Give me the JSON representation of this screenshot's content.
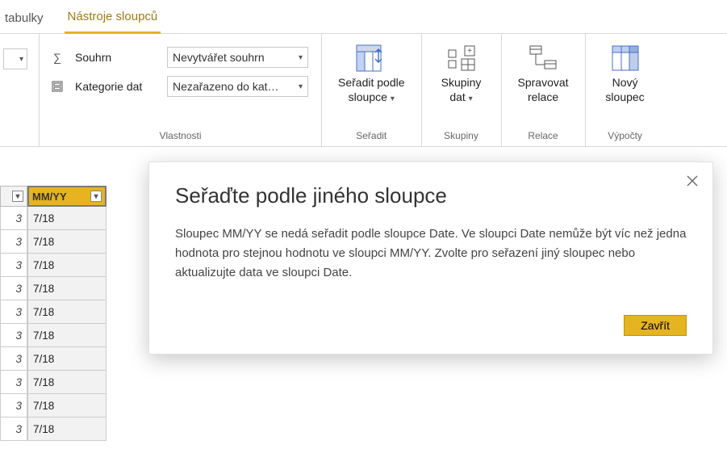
{
  "tabs": {
    "tabulky": "tabulky",
    "nastroje": "Nástroje sloupců"
  },
  "ribbon": {
    "vlastnosti": {
      "souhrn_label": "Souhrn",
      "souhrn_value": "Nevytvářet souhrn",
      "kategorie_label": "Kategorie dat",
      "kategorie_value": "Nezařazeno do kat…",
      "group_label": "Vlastnosti"
    },
    "seradit": {
      "label_line1": "Seřadit podle",
      "label_line2": "sloupce",
      "group_label": "Seřadit"
    },
    "skupiny": {
      "label_line1": "Skupiny",
      "label_line2": "dat",
      "group_label": "Skupiny"
    },
    "relace": {
      "label_line1": "Spravovat",
      "label_line2": "relace",
      "group_label": "Relace"
    },
    "vypocty": {
      "label_line1": "Nový",
      "label_line2": "sloupec",
      "group_label": "Výpočty"
    }
  },
  "grid": {
    "col_b_header": "MM/YY",
    "rows": [
      {
        "a": "3",
        "b": "7/18"
      },
      {
        "a": "3",
        "b": "7/18"
      },
      {
        "a": "3",
        "b": "7/18"
      },
      {
        "a": "3",
        "b": "7/18"
      },
      {
        "a": "3",
        "b": "7/18"
      },
      {
        "a": "3",
        "b": "7/18"
      },
      {
        "a": "3",
        "b": "7/18"
      },
      {
        "a": "3",
        "b": "7/18"
      },
      {
        "a": "3",
        "b": "7/18"
      },
      {
        "a": "3",
        "b": "7/18"
      }
    ]
  },
  "dialog": {
    "title": "Seřaďte podle jiného sloupce",
    "body": "Sloupec MM/YY se nedá seřadit podle sloupce Date. Ve sloupci Date nemůže být víc než jedna hodnota pro stejnou hodnotu ve sloupci MM/YY. Zvolte pro seřazení jiný sloupec nebo aktualizujte data ve sloupci Date.",
    "close_label": "Zavřít"
  }
}
